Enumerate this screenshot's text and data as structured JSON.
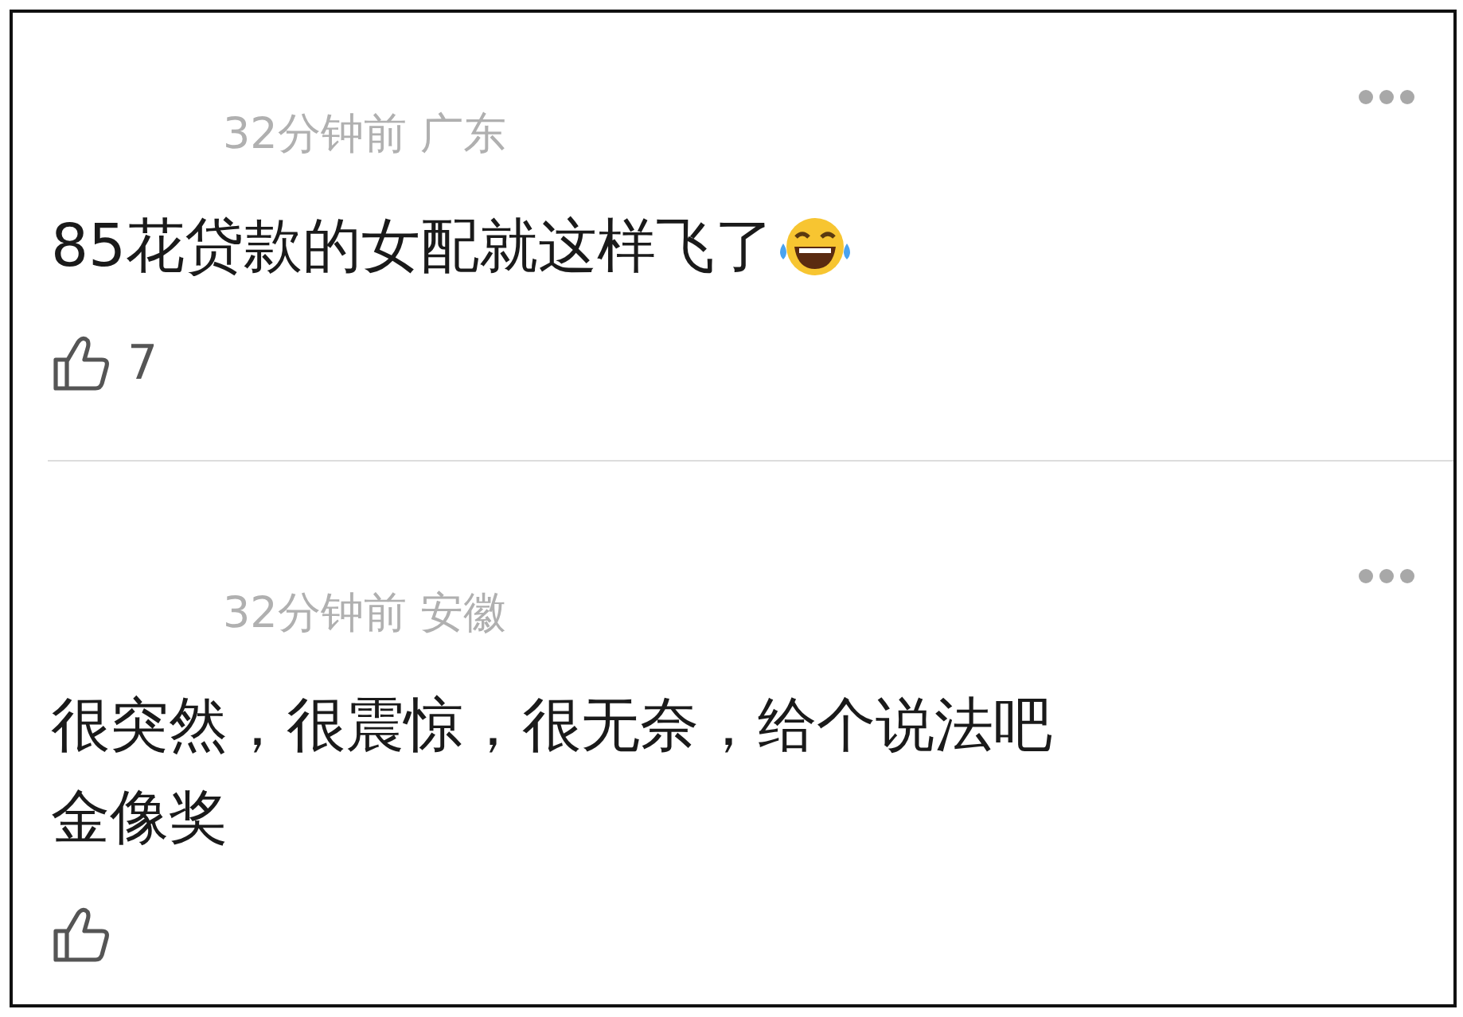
{
  "comments": [
    {
      "kind": "with_emoji",
      "meta": "32分钟前 广东",
      "lines": [
        "85花贷款的女配就这样飞了"
      ],
      "likes": "7"
    },
    {
      "kind": "plain",
      "meta": "32分钟前 安徽",
      "lines": [
        "很突然，很震惊，很无奈，给个说法吧",
        "金像奖"
      ]
    }
  ]
}
